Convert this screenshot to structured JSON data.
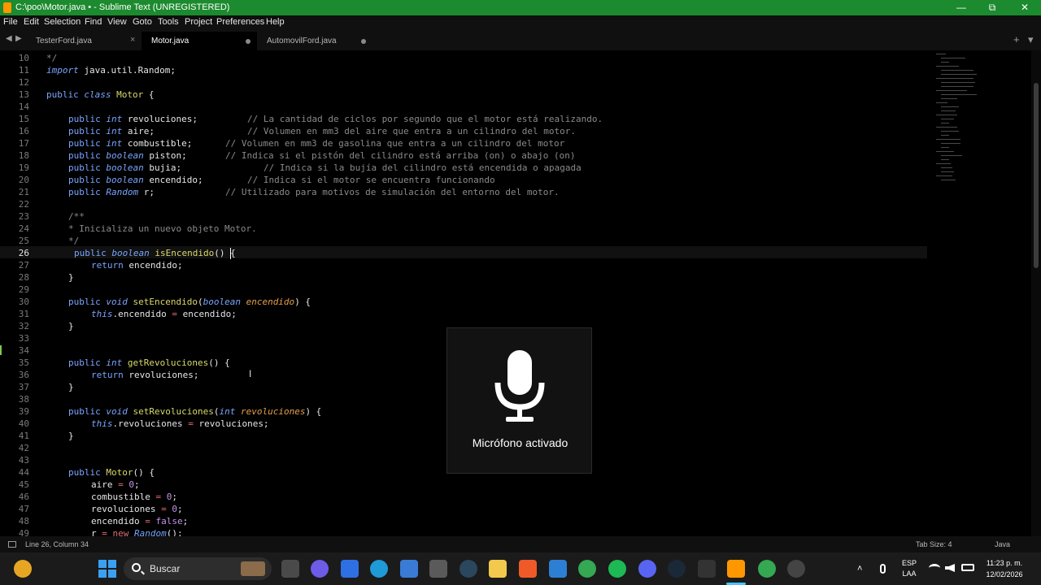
{
  "window": {
    "title": "C:\\poo\\Motor.java • - Sublime Text (UNREGISTERED)",
    "minimize_glyph": "—",
    "maximize_glyph": "⧉",
    "close_glyph": "✕"
  },
  "menu": [
    "File",
    "Edit",
    "Selection",
    "Find",
    "View",
    "Goto",
    "Tools",
    "Project",
    "Preferences",
    "Help"
  ],
  "tabs": [
    {
      "label": "TesterFord.java",
      "state": "close"
    },
    {
      "label": "Motor.java",
      "state": "modified",
      "active": true
    },
    {
      "label": "AutomovilFord.java",
      "state": "modified"
    }
  ],
  "tab_controls": {
    "back": "◀",
    "forward": "▶",
    "new_tab": "+",
    "tab_menu": "▾",
    "close": "×"
  },
  "editor": {
    "current_line": 26,
    "line_numbers": [
      10,
      11,
      12,
      13,
      14,
      15,
      16,
      17,
      18,
      19,
      20,
      21,
      22,
      23,
      24,
      25,
      26,
      27,
      28,
      29,
      30,
      31,
      32,
      33,
      34,
      35,
      36,
      37,
      38,
      39,
      40,
      41,
      42,
      43,
      44,
      45,
      46,
      47,
      48,
      49
    ]
  },
  "code": {
    "l10": "*/",
    "l11_kw": "import",
    "l11_rest": " java.util.Random;",
    "l13_public": "public",
    "l13_class": " class",
    "l13_name": " Motor",
    "l13_rest": " {",
    "fields": [
      {
        "mod": "public",
        "type": "int",
        "name": " revoluciones;",
        "comment": "// La cantidad de ciclos por segundo que el motor está realizando."
      },
      {
        "mod": "public",
        "type": "int",
        "name": " aire;",
        "comment": "// Volumen en mm3 del aire que entra a un cilindro del motor."
      },
      {
        "mod": "public",
        "type": "int",
        "name": " combustible;",
        "comment": "// Volumen en mm3 de gasolina que entra a un cilindro del motor"
      },
      {
        "mod": "public",
        "type": "boolean",
        "name": " piston;",
        "comment": "// Indica si el pistón del cilindro está arriba (on) o abajo (on)"
      },
      {
        "mod": "public",
        "type": "boolean",
        "name": " bujia;",
        "comment": "// Indica si la bujía del cilindro está encendida o apagada"
      },
      {
        "mod": "public",
        "type": "boolean",
        "name": " encendido;",
        "comment": "// Indica si el motor se encuentra funcionando"
      },
      {
        "mod": "public",
        "type": "Random",
        "name": " r;",
        "comment": "// Utilizado para motivos de simulación del entorno del motor."
      }
    ],
    "l23": "/**",
    "l24": "* Inicializa un nuevo objeto Motor.",
    "l25": "*/",
    "l26_public": "public",
    "l26_type": " boolean",
    "l26_fn": " isEncendido",
    "l26_rest": "() {",
    "l27_kw": "return",
    "l27_rest": " encendido;",
    "brace_close": "}",
    "l30_public": "public",
    "l30_type": " void",
    "l30_fn": " setEncendido",
    "l30_open": "(",
    "l30_ptype": "boolean",
    "l30_param": " encendido",
    "l30_close": ") {",
    "l31_this": "this",
    "l31_field": ".encendido",
    "l31_op": " =",
    "l31_rest": " encendido;",
    "l35_public": "public",
    "l35_type": " int",
    "l35_fn": " getRevoluciones",
    "l35_rest": "() {",
    "l36_kw": "return",
    "l36_rest": " revoluciones;",
    "l39_public": "public",
    "l39_type": " void",
    "l39_fn": " setRevoluciones",
    "l39_open": "(",
    "l39_ptype": "int",
    "l39_param": " revoluciones",
    "l39_close": ") {",
    "l40_this": "this",
    "l40_field": ".revoluciones",
    "l40_op": " =",
    "l40_rest": " revoluciones;",
    "l44_public": "public",
    "l44_fn": " Motor",
    "l44_rest": "() {",
    "l45_name": "aire",
    "l45_op": " =",
    "l45_num": " 0",
    "l45_end": ";",
    "l46_name": "combustible",
    "l46_op": " =",
    "l46_num": " 0",
    "l46_end": ";",
    "l47_name": "revoluciones",
    "l47_op": " =",
    "l47_num": " 0",
    "l47_end": ";",
    "l48_name": "encendido",
    "l48_op": " =",
    "l48_val": " false",
    "l48_end": ";",
    "l49_name": "r",
    "l49_op": " =",
    "l49_new": " new",
    "l49_cls": " Random",
    "l49_end": "();"
  },
  "overlay": {
    "label": "Micrófono activado",
    "icon": "microphone-icon"
  },
  "status": {
    "position": "Line 26, Column 34",
    "tab_size": "Tab Size: 4",
    "syntax": "Java"
  },
  "taskbar": {
    "search_placeholder": "Buscar",
    "language_top": "ESP",
    "language_bottom": "LAA",
    "time": "11:23 p. m.",
    "date": "12/02/2026",
    "tray_chevron": "˄"
  },
  "colors": {
    "titlebar": "#1c8a2e",
    "editor_bg": "#000000",
    "keyword": "#7aa5ff",
    "function": "#d9d96b",
    "comment": "#8a8a8a",
    "number": "#c792ea",
    "operator": "#e06c75"
  }
}
